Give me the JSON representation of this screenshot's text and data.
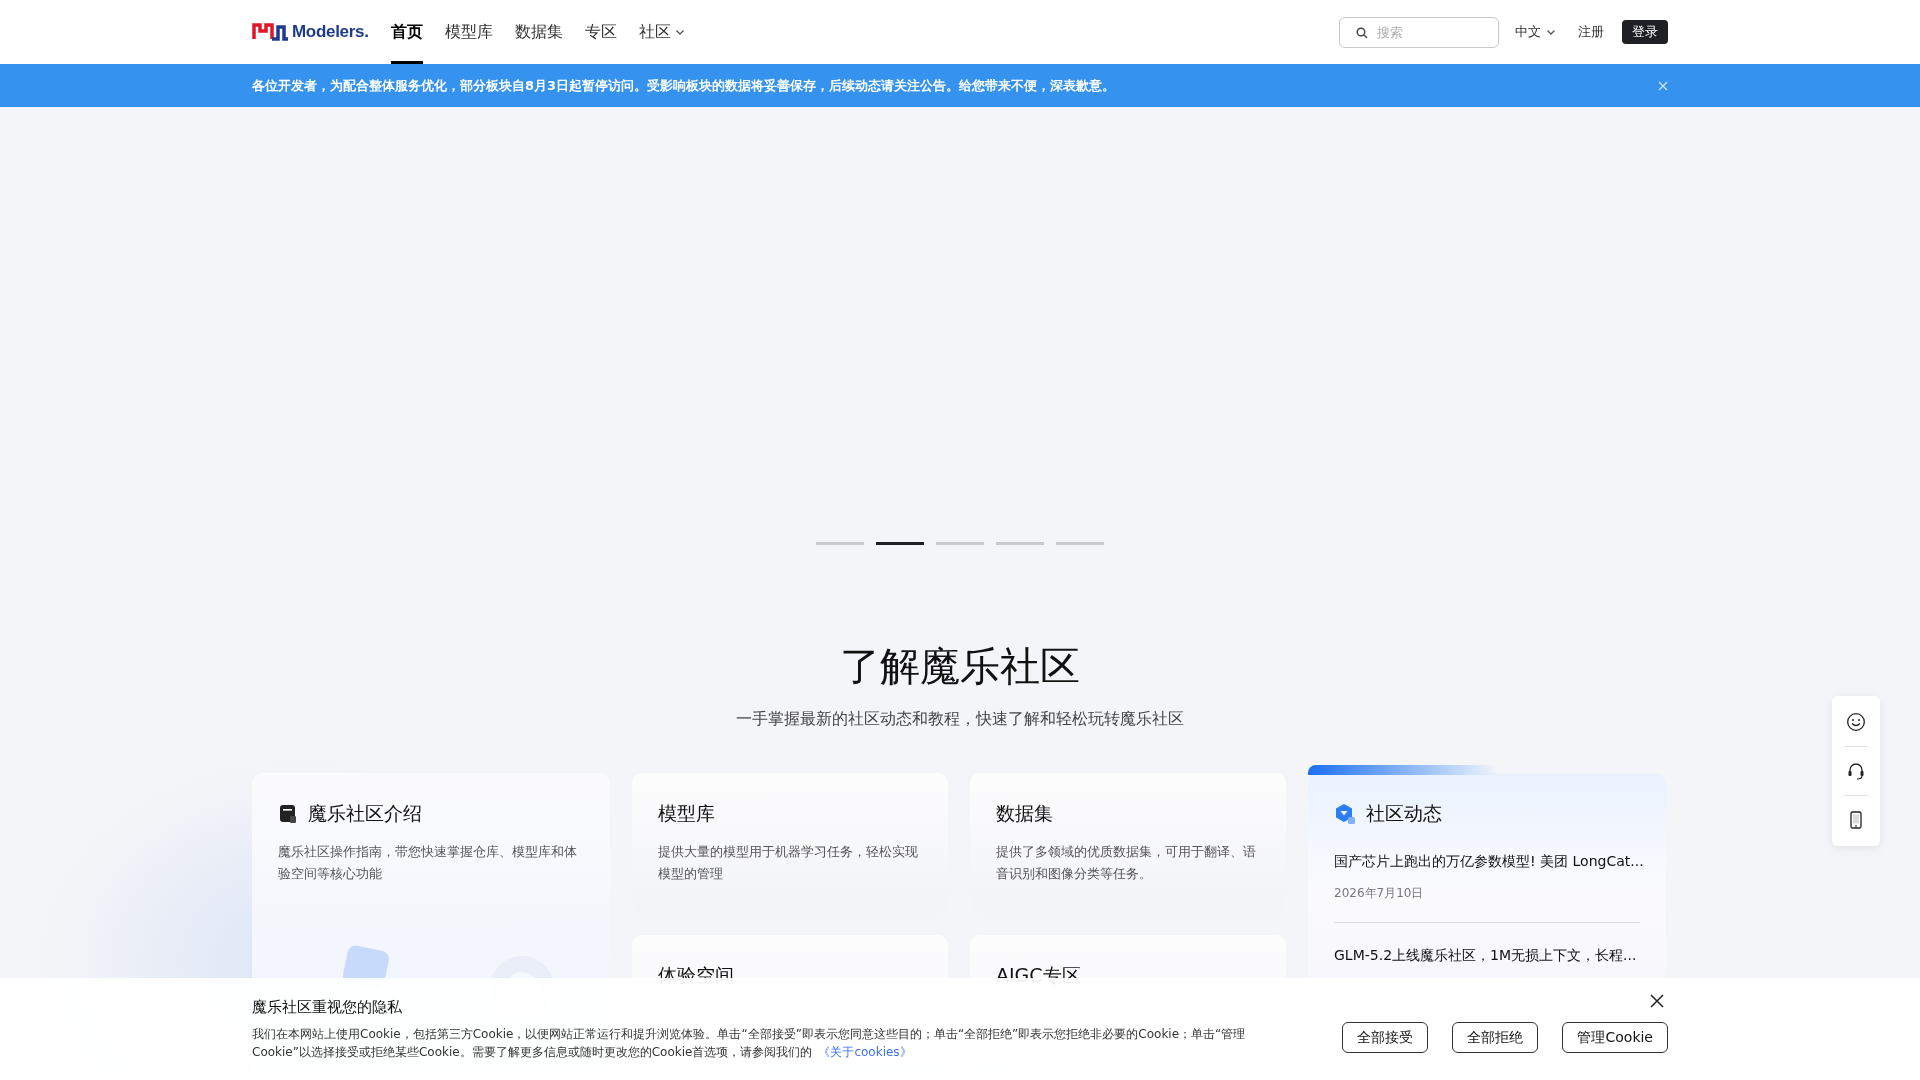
{
  "header": {
    "logo_text": "Modelers.",
    "nav": [
      {
        "label": "首页",
        "selected": true,
        "dropdown": false
      },
      {
        "label": "模型库",
        "selected": false,
        "dropdown": false
      },
      {
        "label": "数据集",
        "selected": false,
        "dropdown": false
      },
      {
        "label": "专区",
        "selected": false,
        "dropdown": false
      },
      {
        "label": "社区",
        "selected": false,
        "dropdown": true
      }
    ],
    "search": {
      "placeholder": "搜索"
    },
    "language": "中文",
    "register": "注册",
    "login": "登录"
  },
  "notice": {
    "text": "各位开发者，为配合整体服务优化，部分板块自8月3日起暂停访问。受影响板块的数据将妥善保存，后续动态请关注公告。给您带来不便，深表歉意。"
  },
  "carousel": {
    "dots": [
      {
        "selected": false
      },
      {
        "selected": true
      },
      {
        "selected": false
      },
      {
        "selected": false
      },
      {
        "selected": false
      }
    ]
  },
  "intro": {
    "title": "了解魔乐社区",
    "subtitle": "一手掌握最新的社区动态和教程，快速了解和轻松玩转魔乐社区",
    "cards": [
      {
        "kind": "guide",
        "title": "魔乐社区介绍",
        "description": "魔乐社区操作指南，带您快速掌握仓库、模型库和体验空间等核心功能"
      },
      {
        "kind": "plain",
        "title": "模型库",
        "description": "提供大量的模型用于机器学习任务，轻松实现模型的管理"
      },
      {
        "kind": "plain",
        "title": "数据集",
        "description": "提供了多领域的优质数据集，可用于翻译、语音识别和图像分类等任务。"
      },
      {
        "kind": "plain",
        "title": "体验空间"
      },
      {
        "kind": "plain",
        "title": "AIGC专区"
      }
    ],
    "news": {
      "title": "社区动态",
      "items": [
        {
          "title": "国产芯片上跑出的万亿参数模型! 美团 LongCat...",
          "date": "2026年7月10日"
        },
        {
          "title": "GLM-5.2上线魔乐社区，1M无损上下文，长程..."
        }
      ]
    }
  },
  "cookie_notice": {
    "title": "魔乐社区重视您的隐私",
    "text": "我们在本网站上使用Cookie，包括第三方Cookie，以便网站正常运行和提升浏览体验。单击“全部接受”即表示您同意这些目的；单击“全部拒绝”即表示您拒绝非必要的Cookie；单击“管理Cookie”以选择接受或拒绝某些Cookie。需要了解更多信息或随时更改您的Cookie首选项，请参阅我们的",
    "link": "《关于cookies》",
    "buttons": [
      "全部接受",
      "全部拒绝",
      "管理Cookie"
    ]
  }
}
